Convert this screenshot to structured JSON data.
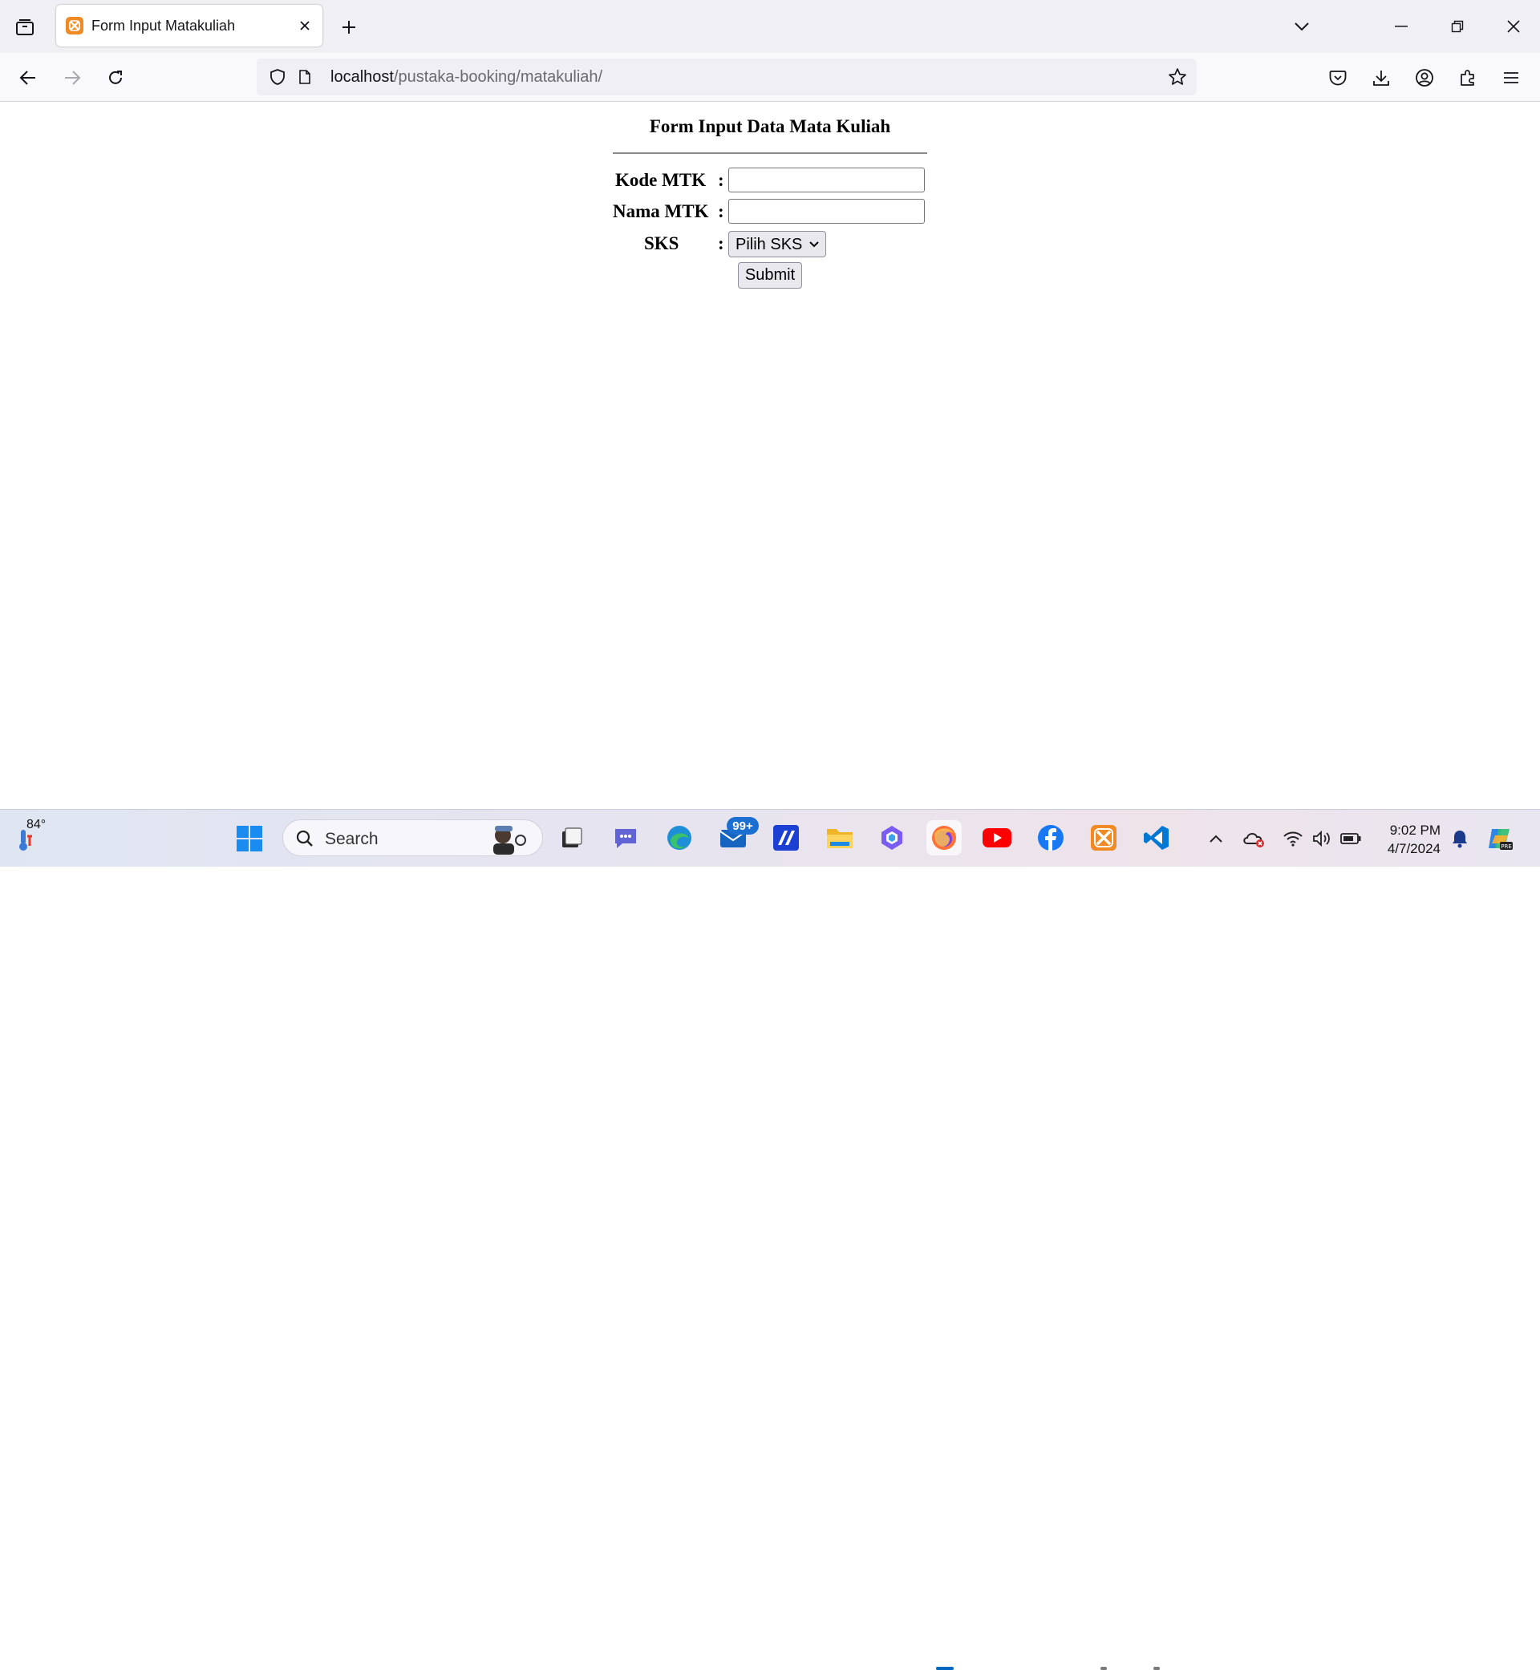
{
  "browser": {
    "tab": {
      "title": "Form Input Matakuliah"
    },
    "url": {
      "host": "localhost",
      "path": "/pustaka-booking/matakuliah/"
    }
  },
  "form": {
    "title": "Form Input Data Mata Kuliah",
    "fields": {
      "kode": {
        "label": "Kode MTK",
        "colon": ":",
        "value": ""
      },
      "nama": {
        "label": "Nama MTK",
        "colon": ":",
        "value": ""
      },
      "sks": {
        "label": "SKS",
        "colon": ":",
        "selected": "Pilih SKS"
      }
    },
    "submit_label": "Submit"
  },
  "taskbar": {
    "weather": "84°",
    "search_label": "Search",
    "mail_badge": "99+",
    "time": "9:02 PM",
    "date": "4/7/2024"
  },
  "colors": {
    "xampp_orange": "#f08a24",
    "firefox_accent": "#0060df",
    "youtube_red": "#ff0000",
    "facebook_blue": "#1877f2",
    "vscode_blue": "#0078d4"
  }
}
